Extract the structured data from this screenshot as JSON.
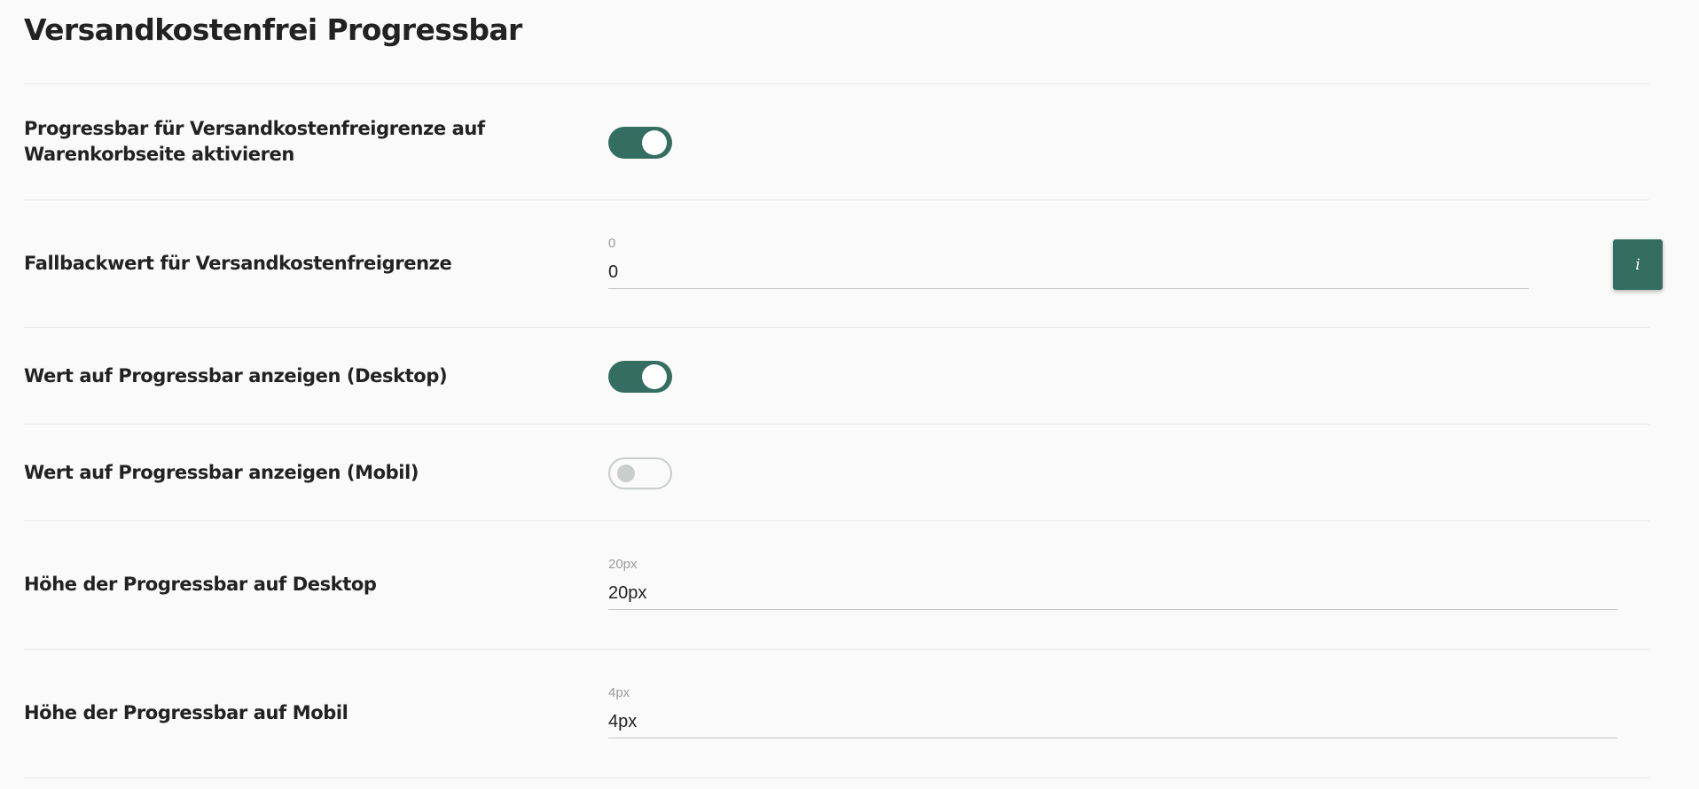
{
  "page": {
    "title": "Versandkostenfrei Progressbar"
  },
  "settings": {
    "enable_cart_progressbar": {
      "label_line1": "Progressbar für Versandkostenfreigrenze auf",
      "label_line2": "Warenkorbseite aktivieren",
      "enabled": true
    },
    "fallback_threshold": {
      "label": "Fallbackwert für Versandkostenfreigrenze",
      "field_label": "0",
      "value": "0",
      "info_icon": "i"
    },
    "show_value_desktop": {
      "label": "Wert auf Progressbar anzeigen (Desktop)",
      "enabled": true
    },
    "show_value_mobile": {
      "label": "Wert auf Progressbar anzeigen (Mobil)",
      "enabled": false
    },
    "height_desktop": {
      "label": "Höhe der Progressbar auf Desktop",
      "field_label": "20px",
      "value": "20px"
    },
    "height_mobile": {
      "label": "Höhe der Progressbar auf Mobil",
      "field_label": "4px",
      "value": "4px"
    }
  },
  "colors": {
    "accent": "#336e61",
    "toggle_off_knob": "#c9cecc",
    "background": "#fafafa"
  }
}
